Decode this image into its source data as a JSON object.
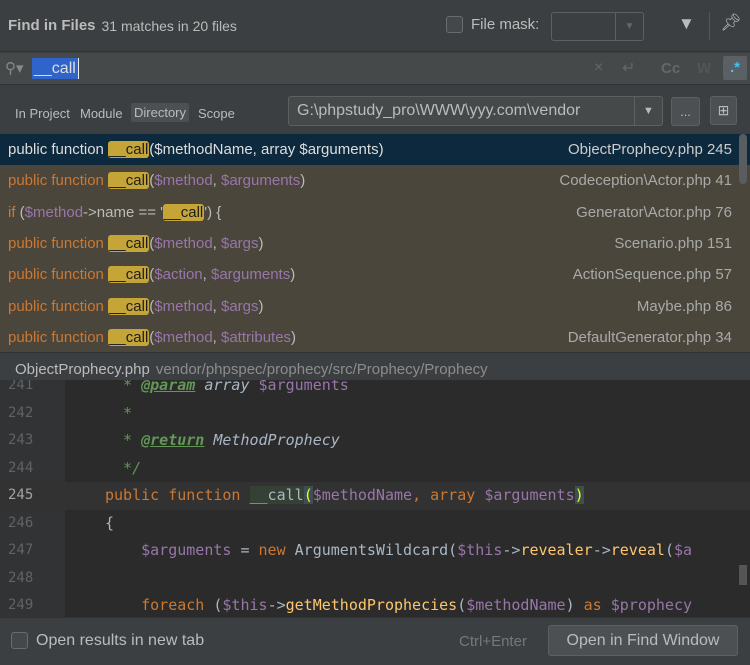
{
  "header": {
    "title": "Find in Files",
    "count": "31 matches in 20 files",
    "file_mask_label": "File mask:",
    "file_mask_value": ""
  },
  "search": {
    "query": "__call",
    "clear_icon": "×",
    "newline_icon": "↵",
    "case_label": "Cc",
    "word_label": "W",
    "regex_label": ".*"
  },
  "scope": {
    "tabs": [
      "In Project",
      "Module",
      "Directory",
      "Scope"
    ],
    "active": "Directory",
    "path": "G:\\phpstudy_pro\\WWW\\yyy.com\\vendor",
    "browse_label": "..."
  },
  "results": [
    {
      "tokens": [
        [
          "kw",
          "public function "
        ],
        [
          "hl",
          "__call"
        ],
        [
          "pl",
          "("
        ],
        [
          "var",
          "$methodName"
        ],
        [
          "pl",
          ", "
        ],
        [
          "kw",
          "array "
        ],
        [
          "var",
          "$arguments"
        ],
        [
          "pl",
          ")"
        ]
      ],
      "file": "ObjectProphecy.php 245",
      "selected": true
    },
    {
      "tokens": [
        [
          "kw",
          "public function "
        ],
        [
          "hl",
          "__call"
        ],
        [
          "pl",
          "("
        ],
        [
          "var",
          "$method"
        ],
        [
          "pl",
          ", "
        ],
        [
          "var",
          "$arguments"
        ],
        [
          "pl",
          ")"
        ]
      ],
      "file": "Codeception\\Actor.php 41"
    },
    {
      "tokens": [
        [
          "kw",
          "if "
        ],
        [
          "pl",
          "("
        ],
        [
          "var",
          "$method"
        ],
        [
          "pl",
          "->name == '"
        ],
        [
          "hl",
          "__call"
        ],
        [
          "pl",
          "') {"
        ]
      ],
      "file": "Generator\\Actor.php 76"
    },
    {
      "tokens": [
        [
          "kw",
          "public function "
        ],
        [
          "hl",
          "__call"
        ],
        [
          "pl",
          "("
        ],
        [
          "var",
          "$method"
        ],
        [
          "pl",
          ", "
        ],
        [
          "var",
          "$args"
        ],
        [
          "pl",
          ")"
        ]
      ],
      "file": "Scenario.php 151"
    },
    {
      "tokens": [
        [
          "kw",
          "public function "
        ],
        [
          "hl",
          "__call"
        ],
        [
          "pl",
          "("
        ],
        [
          "var",
          "$action"
        ],
        [
          "pl",
          ", "
        ],
        [
          "var",
          "$arguments"
        ],
        [
          "pl",
          ")"
        ]
      ],
      "file": "ActionSequence.php 57"
    },
    {
      "tokens": [
        [
          "kw",
          "public function "
        ],
        [
          "hl",
          "__call"
        ],
        [
          "pl",
          "("
        ],
        [
          "var",
          "$method"
        ],
        [
          "pl",
          ", "
        ],
        [
          "var",
          "$args"
        ],
        [
          "pl",
          ")"
        ]
      ],
      "file": "Maybe.php 86"
    },
    {
      "tokens": [
        [
          "kw",
          "public function "
        ],
        [
          "hl",
          "__call"
        ],
        [
          "pl",
          "("
        ],
        [
          "var",
          "$method"
        ],
        [
          "pl",
          ", "
        ],
        [
          "var",
          "$attributes"
        ],
        [
          "pl",
          ")"
        ]
      ],
      "file": "DefaultGenerator.php 34"
    }
  ],
  "preview": {
    "file": "ObjectProphecy.php",
    "dir": "vendor/phpspec/prophecy/src/Prophecy/Prophecy"
  },
  "code": [
    {
      "n": "241",
      "tokens": [
        [
          "cm",
          "  * "
        ],
        [
          "tag",
          "@param"
        ],
        [
          "ty",
          " array "
        ],
        [
          "var",
          "$arguments"
        ]
      ]
    },
    {
      "n": "242",
      "tokens": [
        [
          "cm",
          "  *"
        ]
      ]
    },
    {
      "n": "243",
      "tokens": [
        [
          "cm",
          "  * "
        ],
        [
          "tag",
          "@return"
        ],
        [
          "ty",
          " MethodProphecy"
        ]
      ]
    },
    {
      "n": "244",
      "tokens": [
        [
          "cm",
          "  */"
        ]
      ]
    },
    {
      "n": "245",
      "current": true,
      "tokens": [
        [
          "kw",
          "public function "
        ],
        [
          "hl",
          "__call"
        ],
        [
          "br",
          "("
        ],
        [
          "var",
          "$methodName"
        ],
        [
          "kw",
          ", array "
        ],
        [
          "var",
          "$arguments"
        ],
        [
          "br",
          ")"
        ]
      ]
    },
    {
      "n": "246",
      "tokens": [
        [
          "pl",
          "{"
        ]
      ]
    },
    {
      "n": "247",
      "tokens": [
        [
          "var",
          "    $arguments"
        ],
        [
          "pl",
          " = "
        ],
        [
          "kw",
          "new "
        ],
        [
          "pl",
          "ArgumentsWildcard("
        ],
        [
          "var",
          "$this"
        ],
        [
          "pl",
          "->"
        ],
        [
          "fn",
          "revealer"
        ],
        [
          "pl",
          "->"
        ],
        [
          "fn",
          "reveal"
        ],
        [
          "pl",
          "("
        ],
        [
          "var",
          "$a"
        ]
      ]
    },
    {
      "n": "248",
      "tokens": []
    },
    {
      "n": "249",
      "tokens": [
        [
          "kw",
          "    foreach "
        ],
        [
          "pl",
          "("
        ],
        [
          "var",
          "$this"
        ],
        [
          "pl",
          "->"
        ],
        [
          "fn",
          "getMethodProphecies"
        ],
        [
          "pl",
          "("
        ],
        [
          "var",
          "$methodName"
        ],
        [
          "pl",
          ") "
        ],
        [
          "kw",
          "as "
        ],
        [
          "var",
          "$prophecy"
        ]
      ]
    }
  ],
  "footer": {
    "new_tab_label": "Open results in new tab",
    "shortcut": "Ctrl+Enter",
    "open_button": "Open in Find Window"
  }
}
